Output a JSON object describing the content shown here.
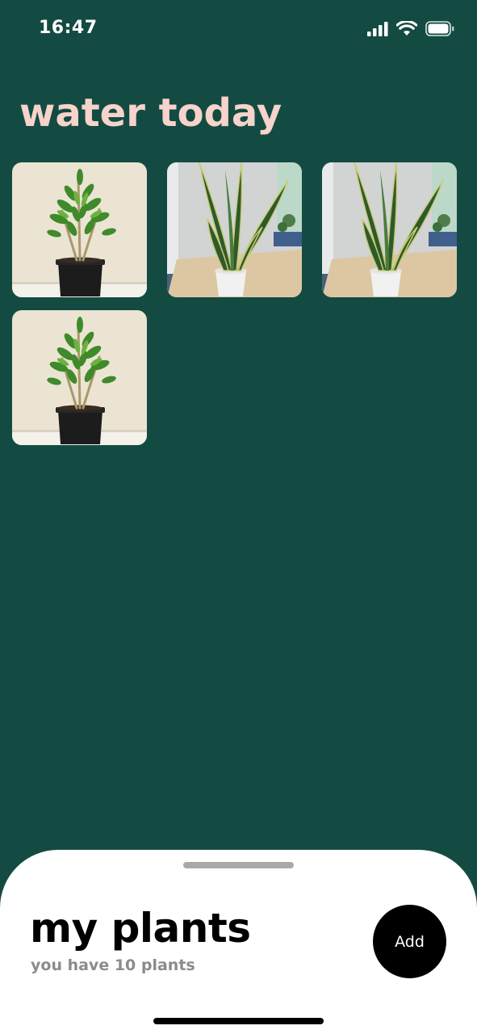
{
  "status_bar": {
    "time": "16:47",
    "icons": [
      "cellular-signal-icon",
      "wifi-icon",
      "battery-icon"
    ]
  },
  "water_today": {
    "title": "water today",
    "plants": [
      {
        "image": "zz-plant-photo"
      },
      {
        "image": "snake-plant-photo"
      },
      {
        "image": "snake-plant-photo"
      },
      {
        "image": "zz-plant-photo"
      }
    ]
  },
  "my_plants": {
    "title": "my plants",
    "subtitle": "you have 10 plants",
    "add_label": "Add"
  },
  "colors": {
    "background": "#134b42",
    "heading": "#f6d3cb",
    "sheet": "#ffffff",
    "add_button": "#000000"
  }
}
